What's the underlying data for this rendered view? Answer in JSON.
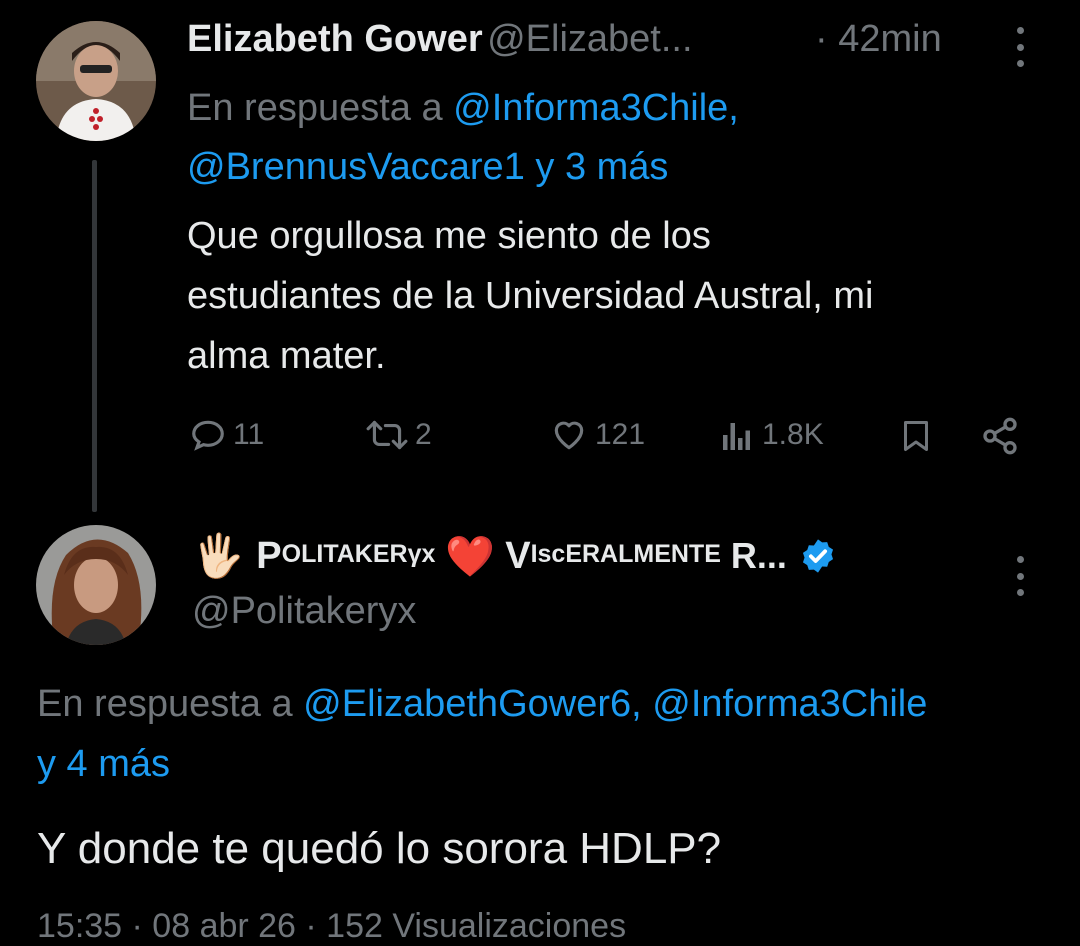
{
  "tweet1": {
    "author_name": "Elizabeth Gower",
    "author_handle": "@Elizabet...",
    "separator": "·",
    "time": "42min",
    "reply_prefix": "En respuesta a",
    "reply_mention_1": "@Informa3Chile,",
    "reply_mention_2": "@BrennusVaccare1",
    "reply_more": "y 3 más",
    "text_line_1": "Que orgullosa me siento de los",
    "text_line_2": "estudiantes de la Universidad Austral, mi",
    "text_line_3": "alma mater.",
    "actions": {
      "replies": "11",
      "reposts": "2",
      "likes": "121",
      "views": "1.8K"
    }
  },
  "tweet2": {
    "author_emoji_hand": "🖐🏻",
    "author_name_part1_big": "P",
    "author_name_part1_rest": "OLITAKERγx",
    "author_emoji_heart": "❤️",
    "author_name_part2_big": "V",
    "author_name_part2_rest": "IscERALMENTE",
    "author_name_part3": "R...",
    "author_handle": "@Politakeryx",
    "reply_prefix": "En respuesta a",
    "reply_mention_1": "@ElizabethGower6,",
    "reply_mention_2": "@Informa3Chile",
    "reply_more": "y 4 más",
    "text": "Y donde te quedó lo sorora HDLP?",
    "meta_cut": "15:35 · 08 abr 26 · 152 Visualizaciones"
  },
  "colors": {
    "background": "#000000",
    "text": "#e7e9ea",
    "muted": "#71767b",
    "link": "#1d9bf0",
    "verified": "#1d9bf0",
    "heart_emoji": "#ff2d55"
  },
  "icons": {
    "reply": "reply-icon",
    "repost": "repost-icon",
    "like": "like-icon",
    "views": "views-icon",
    "bookmark": "bookmark-icon",
    "share": "share-icon",
    "more": "more-vertical-icon",
    "verified": "verified-badge-icon"
  }
}
